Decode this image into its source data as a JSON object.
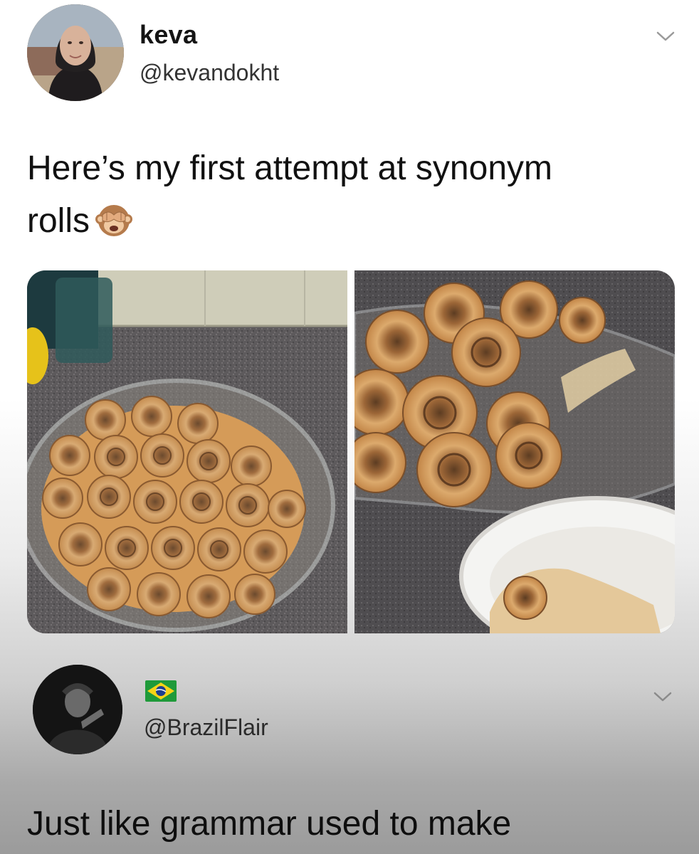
{
  "tweet": {
    "author_name": "keva",
    "author_handle": "@kevandokht",
    "text_line1": "Here’s my first attempt at synonym",
    "text_line2": "rolls",
    "emoji": "see-no-evil-monkey-icon",
    "menu_icon": "chevron-down-icon",
    "images": [
      {
        "alt": "cinnamon rolls in a glass dish"
      },
      {
        "alt": "cinnamon rolls in a glass dish with a plate"
      }
    ]
  },
  "reply": {
    "author_handle": "@BrazilFlair",
    "flag_icon": "brazil-flag-icon",
    "menu_icon": "chevron-down-icon",
    "text": "Just like grammar used to make"
  },
  "colors": {
    "text": "#141414",
    "handle": "#333333",
    "chevron": "#9a9a9a",
    "fade_bottom": "#9b9b9b"
  }
}
